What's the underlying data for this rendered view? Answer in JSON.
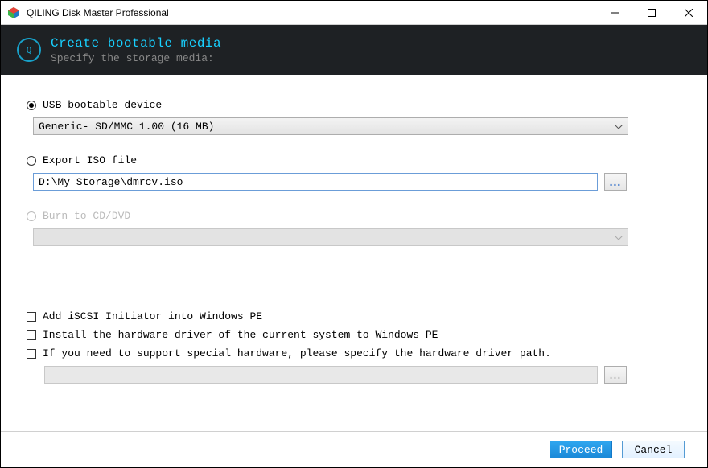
{
  "window": {
    "title": "QILING Disk Master Professional"
  },
  "header": {
    "title": "Create bootable media",
    "subtitle": "Specify the storage media:"
  },
  "options": {
    "usb": {
      "label": "USB bootable device",
      "selected": true,
      "device": "Generic- SD/MMC 1.00 (16 MB)"
    },
    "iso": {
      "label": "Export ISO file",
      "selected": false,
      "path": "D:\\My Storage\\dmrcv.iso",
      "browse": "..."
    },
    "cddvd": {
      "label": "Burn to CD/DVD",
      "selected": false,
      "disabled": true,
      "device": ""
    }
  },
  "checkboxes": {
    "iscsi": "Add iSCSI Initiator into Windows PE",
    "hwdriver": "Install the hardware driver of the current system to Windows PE",
    "special": "If you need to support special hardware, please specify the hardware driver path.",
    "driver_path": "",
    "browse": "..."
  },
  "footer": {
    "proceed": "Proceed",
    "cancel": "Cancel"
  }
}
